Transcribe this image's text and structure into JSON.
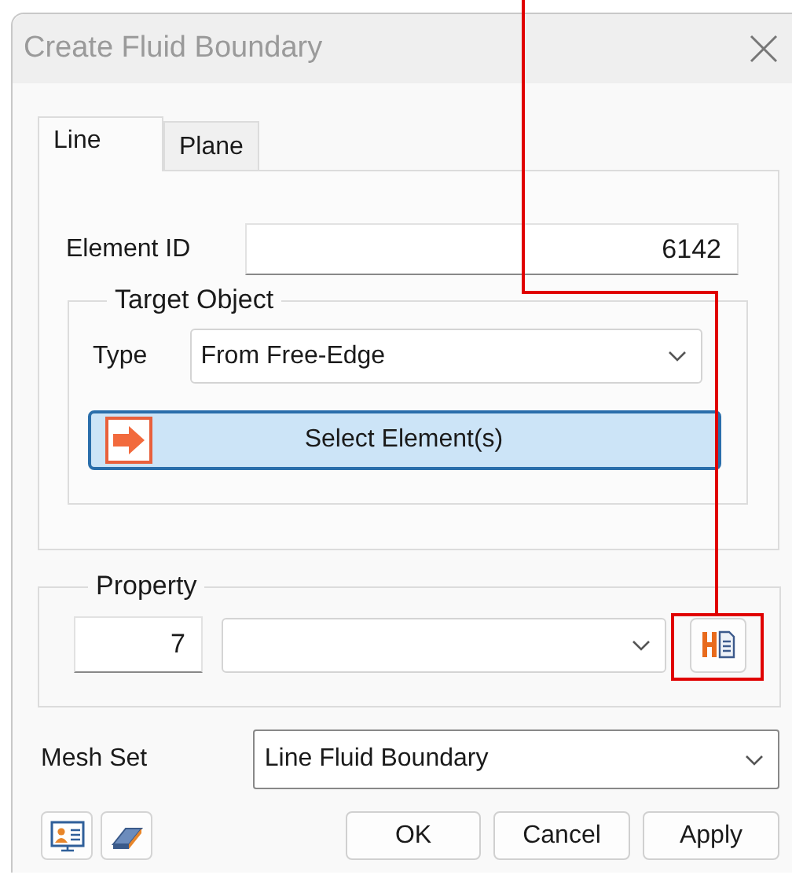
{
  "window": {
    "title": "Create Fluid Boundary"
  },
  "tabs": [
    {
      "label": "Line",
      "selected": true
    },
    {
      "label": "Plane",
      "selected": false
    }
  ],
  "element_id": {
    "label": "Element ID",
    "value": "6142"
  },
  "target_object": {
    "title": "Target Object",
    "type_label": "Type",
    "type_value": "From Free-Edge",
    "select_button": "Select Element(s)"
  },
  "property": {
    "title": "Property",
    "id_value": "7"
  },
  "mesh_set": {
    "label": "Mesh Set",
    "value": "Line Fluid Boundary"
  },
  "buttons": [
    "OK",
    "Cancel",
    "Apply"
  ],
  "annotation": {
    "kind": "callout"
  }
}
